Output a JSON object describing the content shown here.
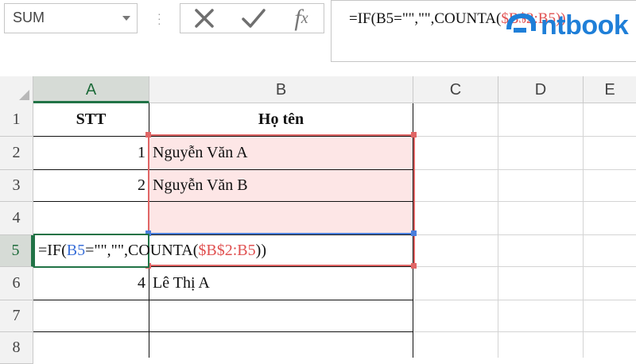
{
  "name_box": {
    "value": "SUM"
  },
  "formula_bar": {
    "parts": [
      "=IF(",
      "B5",
      "=\"\",\"\",COUNTA(",
      "$B$2:B5",
      "))"
    ]
  },
  "logo": {
    "text": "ntbook"
  },
  "columns": [
    "A",
    "B",
    "C",
    "D",
    "E"
  ],
  "rows": [
    "1",
    "2",
    "3",
    "4",
    "5",
    "6",
    "7",
    "8"
  ],
  "cells": {
    "A1": "STT",
    "B1": "Họ tên",
    "A2": "1",
    "B2": "Nguyễn Văn A",
    "A3": "2",
    "B3": "Nguyễn Văn B",
    "A6": "4",
    "B6": "Lê Thị A"
  },
  "editing_cell": {
    "parts": [
      "=IF(",
      "B5",
      "=\"\",\"\",COUNTA(",
      "$B$2:B5",
      "))"
    ]
  },
  "colors": {
    "selection_green": "#217346",
    "ref_blue": "#3a6fd8",
    "ref_red": "#e05050",
    "logo_blue": "#1f7fd8"
  }
}
